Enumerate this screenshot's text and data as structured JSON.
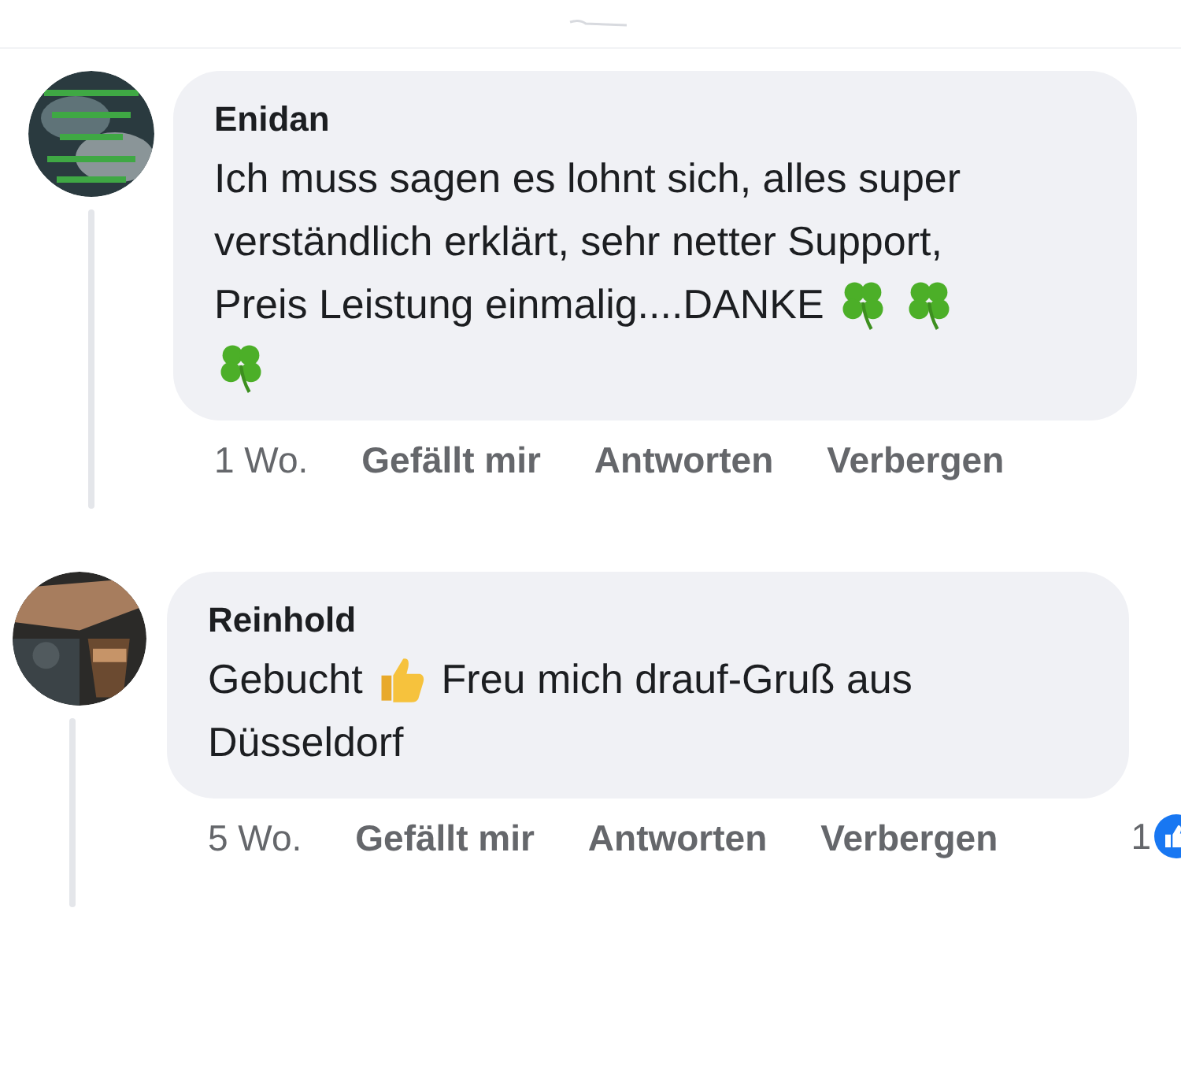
{
  "comments": [
    {
      "author": "Enidan",
      "avatar": {
        "kind": "picture"
      },
      "lines": [
        [
          {
            "kind": "text",
            "text": "Ich muss sagen es lohnt sich, alles super"
          }
        ],
        [
          {
            "kind": "text",
            "text": "verständlich erklärt, sehr netter Support,"
          }
        ],
        [
          {
            "kind": "text",
            "text": "Preis Leistung einmalig....DANKE"
          },
          {
            "kind": "clover"
          },
          {
            "kind": "clover"
          }
        ],
        [
          {
            "kind": "clover"
          }
        ]
      ],
      "time": "1 Wo.",
      "actions": [
        "Gefällt mir",
        "Antworten",
        "Verbergen"
      ]
    },
    {
      "author": "Reinhold",
      "avatar": {
        "kind": "picture"
      },
      "lines": [
        [
          {
            "kind": "text",
            "text": "Gebucht"
          },
          {
            "kind": "thumbs-up"
          },
          {
            "kind": "text",
            "text": "Freu mich drauf-Gruß aus"
          }
        ],
        [
          {
            "kind": "text",
            "text": "Düsseldorf"
          }
        ]
      ],
      "time": "5 Wo.",
      "actions": [
        "Gefällt mir",
        "Antworten",
        "Verbergen"
      ],
      "reactions": {
        "count": "1"
      }
    }
  ]
}
